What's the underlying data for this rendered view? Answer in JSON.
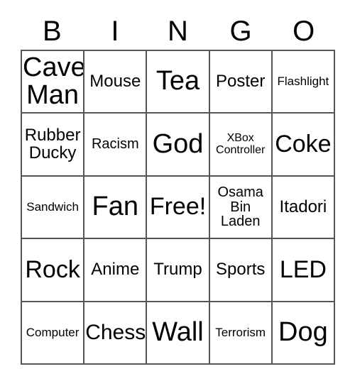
{
  "card": {
    "title_letters": [
      "B",
      "I",
      "N",
      "G",
      "O"
    ],
    "border_color": "#555555",
    "text_color": "#000000",
    "background_color": "#ffffff",
    "rows": 5,
    "columns": 5,
    "cells": [
      [
        {
          "label": "Cave\nMan",
          "size": "fs-xxl"
        },
        {
          "label": "Mouse",
          "size": "fs-m"
        },
        {
          "label": "Tea",
          "size": "fs-xxl"
        },
        {
          "label": "Poster",
          "size": "fs-m"
        },
        {
          "label": "Flashlight",
          "size": "fs-xs"
        }
      ],
      [
        {
          "label": "Rubber\nDucky",
          "size": "fs-m"
        },
        {
          "label": "Racism",
          "size": "fs-s"
        },
        {
          "label": "God",
          "size": "fs-xxl"
        },
        {
          "label": "XBox\nController",
          "size": "fs-xxs"
        },
        {
          "label": "Coke",
          "size": "fs-xl"
        }
      ],
      [
        {
          "label": "Sandwich",
          "size": "fs-xs"
        },
        {
          "label": "Fan",
          "size": "fs-xxl"
        },
        {
          "label": "Free!",
          "size": "fs-xl"
        },
        {
          "label": "Osama\nBin\nLaden",
          "size": "fs-s"
        },
        {
          "label": "Itadori",
          "size": "fs-m"
        }
      ],
      [
        {
          "label": "Rock",
          "size": "fs-xl"
        },
        {
          "label": "Anime",
          "size": "fs-m"
        },
        {
          "label": "Trump",
          "size": "fs-m"
        },
        {
          "label": "Sports",
          "size": "fs-m"
        },
        {
          "label": "LED",
          "size": "fs-xl"
        }
      ],
      [
        {
          "label": "Computer",
          "size": "fs-xs"
        },
        {
          "label": "Chess",
          "size": "fs-l"
        },
        {
          "label": "Wall",
          "size": "fs-xxl"
        },
        {
          "label": "Terrorism",
          "size": "fs-xs"
        },
        {
          "label": "Dog",
          "size": "fs-xxl"
        }
      ]
    ]
  }
}
